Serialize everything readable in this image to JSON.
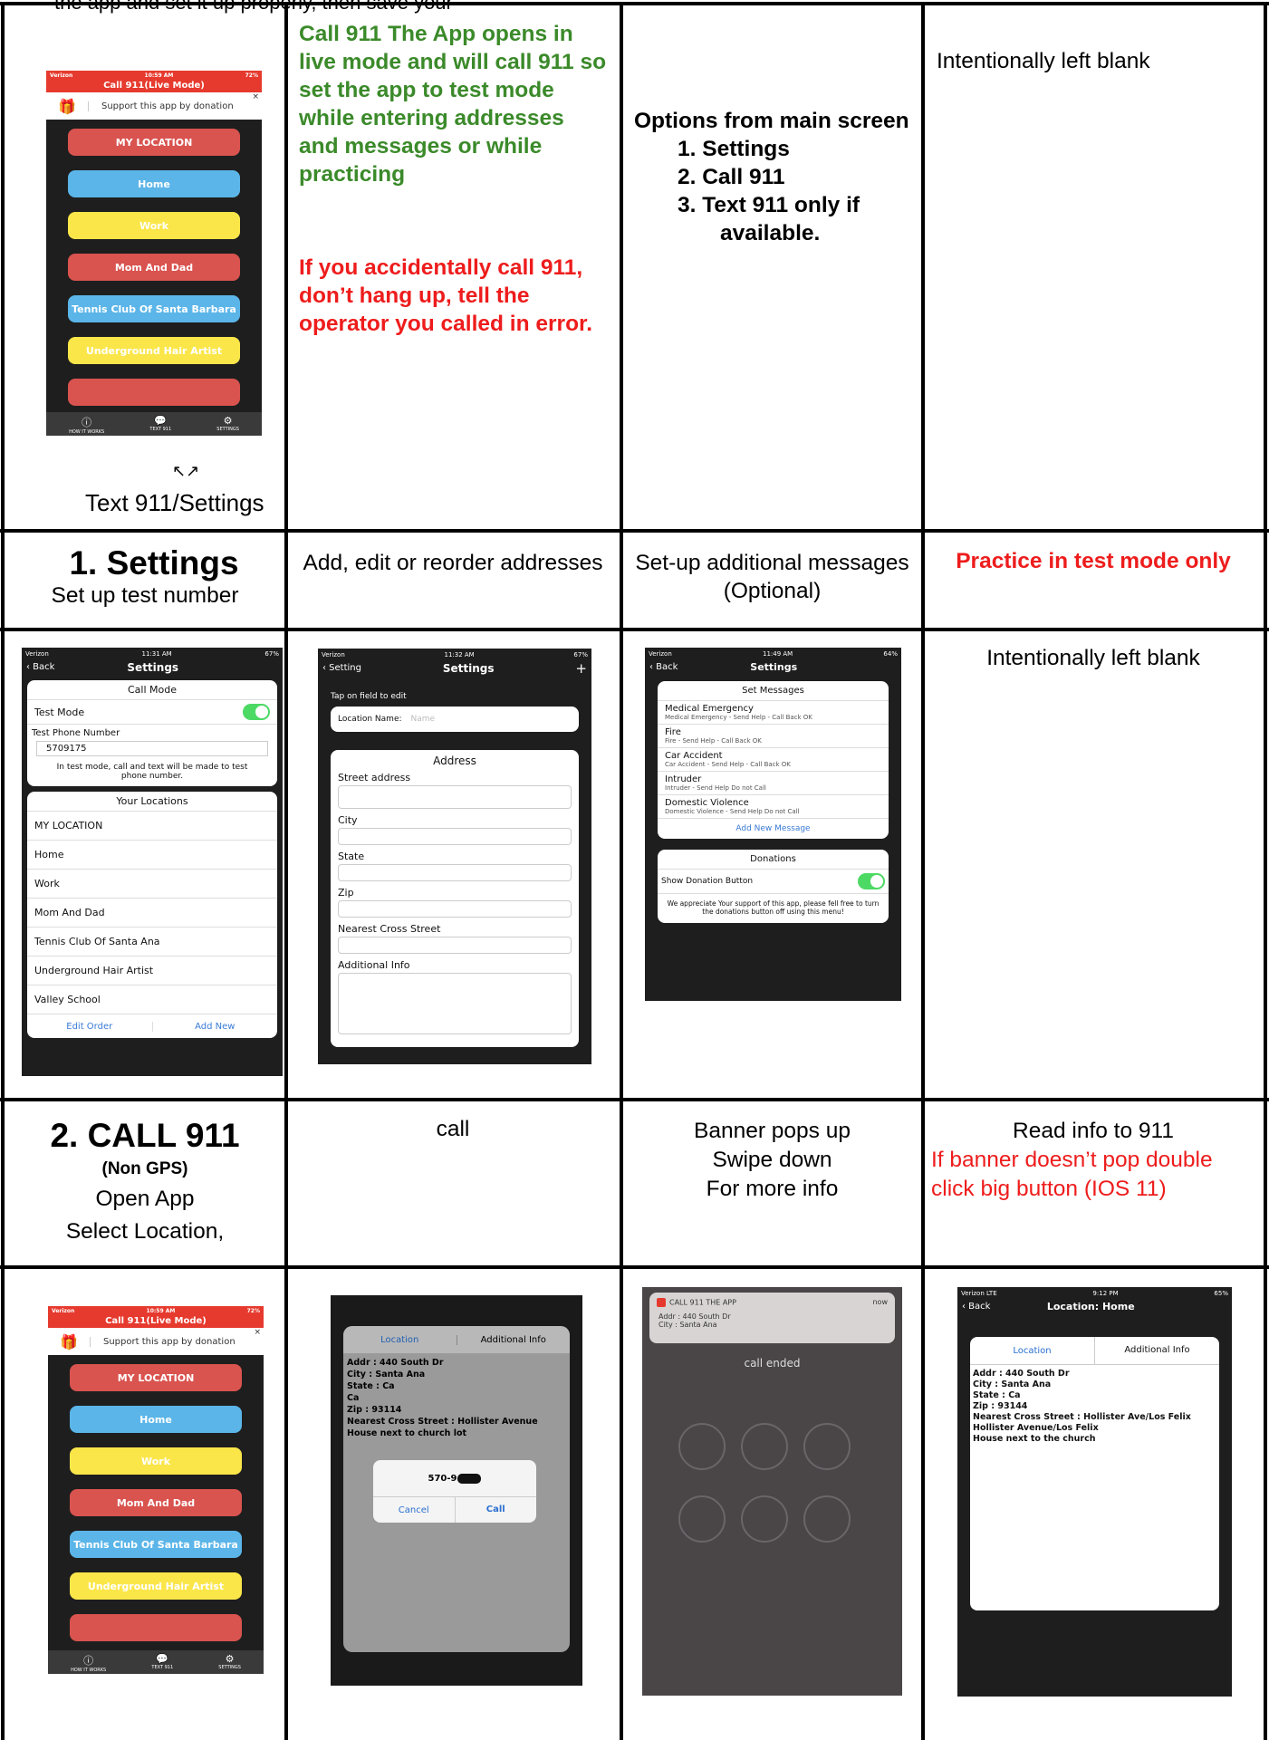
{
  "top_caption": "the app and set it up properly, then save your",
  "row1": {
    "c1_caption": "Text 911/Settings",
    "c1_arrows": "↖↗",
    "c2_green": "Call 911 The App opens in live mode and will call 911 so set the app to test mode while entering addresses and messages or while practicing",
    "c2_red": "If you accidentally call 911, don’t hang up, tell the operator you called in error.",
    "c3_heading": "Options from main screen",
    "c3_items": [
      "1.  Settings",
      "2.  Call 911",
      "3.  Text 911 only if available."
    ],
    "c4": "Intentionally left blank"
  },
  "row2": {
    "c1_title": "1.  Settings",
    "c1_sub": "Set up test number",
    "c2": "Add, edit or reorder addresses",
    "c3": "Set-up additional messages (Optional)",
    "c4": "Practice in test mode only"
  },
  "row3": {
    "c4": "Intentionally left blank"
  },
  "row4": {
    "c1_title": "2. CALL 911",
    "c1_nongps": "(Non GPS)",
    "c1_line1": "Open App",
    "c1_line2": "Select Location,",
    "c2": "call",
    "c3_l1": "Banner pops up",
    "c3_l2": "Swipe down",
    "c3_l3": "For more info",
    "c4_black": "Read info to 911",
    "c4_red": "If banner doesn’t  pop double click big button (IOS 11)"
  },
  "home_screen": {
    "carrier": "Verizon",
    "time": "10:59 AM",
    "battery": "72%",
    "title": "Call 911(Live Mode)",
    "donation": "Support this app by donation",
    "close": "×",
    "buttons": [
      {
        "label": "MY LOCATION",
        "color": "#d9534f"
      },
      {
        "label": "Home",
        "color": "#5bb5e8"
      },
      {
        "label": "Work",
        "color": "#fbe64a"
      },
      {
        "label": "Mom And Dad",
        "color": "#d9534f"
      },
      {
        "label": "Tennis Club Of Santa Barbara",
        "color": "#5bb5e8"
      },
      {
        "label": "Underground Hair Artist",
        "color": "#fbe64a"
      }
    ],
    "tabs": [
      "HOW IT WORKS",
      "TEXT 911",
      "SETTINGS"
    ],
    "tab_icons": [
      "ⓘ",
      "💬",
      "⚙"
    ]
  },
  "settings_screen": {
    "carrier": "Verizon",
    "time": "11:31 AM",
    "battery": "67%",
    "back": "‹ Back",
    "title": "Settings",
    "call_mode": "Call Mode",
    "test_mode": "Test Mode",
    "test_phone_label": "Test Phone Number",
    "test_phone_value": "5709175",
    "test_note": "In test mode, call and text will be made to test phone number.",
    "your_locations": "Your Locations",
    "locations": [
      "MY LOCATION",
      "Home",
      "Work",
      "Mom And Dad",
      "Tennis Club Of Santa Ana",
      "Underground Hair Artist",
      "Valley School"
    ],
    "edit_order": "Edit Order",
    "add_new": "Add New"
  },
  "address_screen": {
    "carrier": "Verizon",
    "time": "11:32 AM",
    "battery": "67%",
    "back": "‹ Setting",
    "title": "Settings",
    "plus": "+",
    "tap_hint": "Tap on field to edit",
    "location_name_label": "Location Name:",
    "location_name_placeholder": "Name",
    "address_header": "Address",
    "fields": [
      "Street address",
      "City",
      "State",
      "Zip",
      "Nearest Cross Street",
      "Additional Info"
    ]
  },
  "messages_screen": {
    "carrier": "Verizon",
    "time": "11:49 AM",
    "battery": "64%",
    "back": "‹ Back",
    "title": "Settings",
    "set_messages": "Set Messages",
    "messages": [
      {
        "title": "Medical Emergency",
        "sub": "Medical Emergency - Send Help - Call Back OK"
      },
      {
        "title": "Fire",
        "sub": "Fire - Send Help - Call Back OK"
      },
      {
        "title": "Car Accident",
        "sub": "Car Accident - Send Help - Call Back OK"
      },
      {
        "title": "Intruder",
        "sub": "Intruder - Send Help Do not Call"
      },
      {
        "title": "Domestic Violence",
        "sub": "Domestic Violence - Send Help Do not Call"
      }
    ],
    "add_new_message": "Add New Message",
    "donations": "Donations",
    "show_donation": "Show Donation Button",
    "donation_note": "We appreciate Your support of this app, please fell free to turn the donations button off using this menu!"
  },
  "call_dialog": {
    "tab_location": "Location",
    "tab_additional": "Additional Info",
    "lines": [
      "Addr : 440 South Dr",
      "City : Santa Ana",
      "State : Ca",
      "Ca",
      "Zip : 93114",
      "Nearest Cross Street : Hollister Avenue",
      "House next to church lot"
    ],
    "number": "570-9",
    "cancel": "Cancel",
    "call": "Call"
  },
  "banner_screen": {
    "app": "CALL 911 THE APP",
    "when": "now",
    "line1": "Addr : 440 South Dr",
    "line2": "City : Santa Ana",
    "call_ended": "call ended"
  },
  "location_home_screen": {
    "carrier": "Verizon  LTE",
    "time": "9:12 PM",
    "battery": "65%",
    "back": "‹ Back",
    "title": "Location: Home",
    "tab_location": "Location",
    "tab_additional": "Additional Info",
    "lines": [
      "Addr : 440 South Dr",
      "City : Santa Ana",
      "State : Ca",
      "Zip : 93144",
      "Nearest Cross Street : Hollister Ave/Los Felix",
      "Hollister Avenue/Los Felix",
      "House next to the church"
    ]
  }
}
